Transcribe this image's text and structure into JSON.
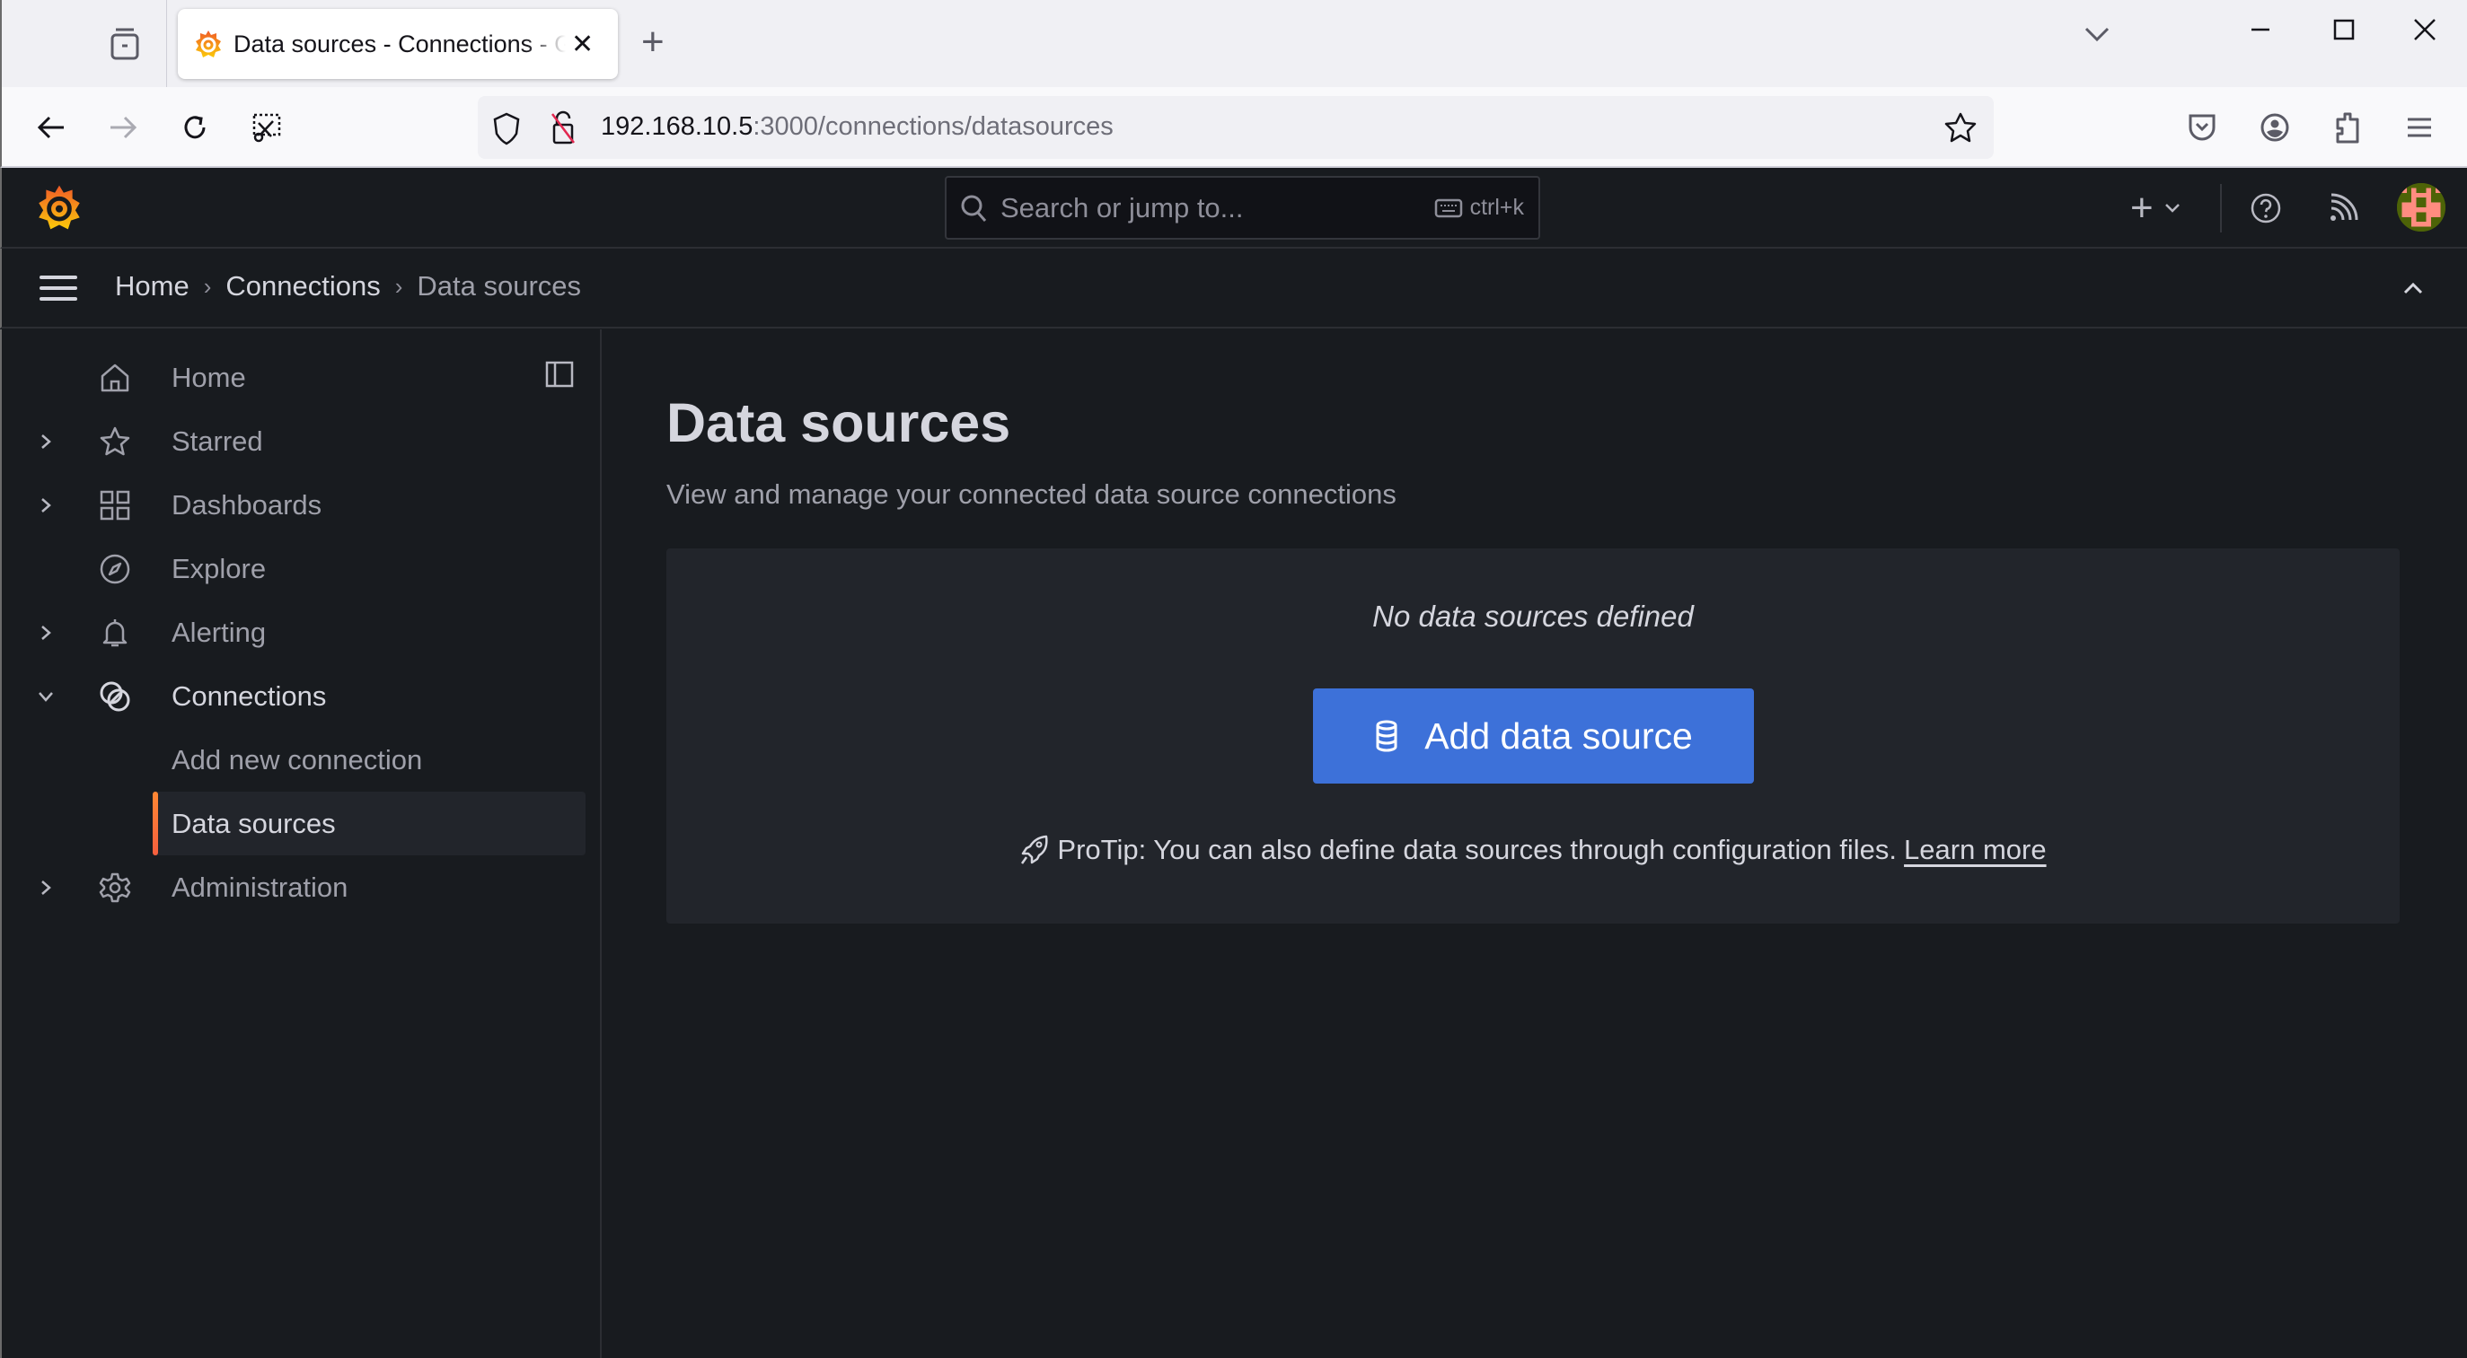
{
  "browser": {
    "tab_title": "Data sources - Connections - Grafana",
    "url_host": "192.168.10.5",
    "url_path": ":3000/connections/datasources",
    "close_tab_glyph": "✕",
    "new_tab_glyph": "+",
    "window_controls": {
      "minimize": "—",
      "maximize": "☐",
      "close": "✕"
    }
  },
  "topbar": {
    "search_placeholder": "Search or jump to...",
    "search_shortcut": "ctrl+k",
    "new_glyph": "+",
    "avatar_colors": {
      "bg": "#4d6307",
      "fg": "#ff8c80"
    }
  },
  "breadcrumb": [
    {
      "label": "Home"
    },
    {
      "label": "Connections"
    },
    {
      "label": "Data sources"
    }
  ],
  "breadcrumb_separator": "›",
  "sidebar": {
    "items": [
      {
        "label": "Home",
        "icon": "home-icon",
        "has_chevron": false
      },
      {
        "label": "Starred",
        "icon": "star-icon",
        "has_chevron": true
      },
      {
        "label": "Dashboards",
        "icon": "apps-icon",
        "has_chevron": true
      },
      {
        "label": "Explore",
        "icon": "compass-icon",
        "has_chevron": false
      },
      {
        "label": "Alerting",
        "icon": "bell-icon",
        "has_chevron": true
      },
      {
        "label": "Connections",
        "icon": "connections-icon",
        "has_chevron": true,
        "expanded": true
      },
      {
        "label": "Add new connection",
        "child": true
      },
      {
        "label": "Data sources",
        "child": true,
        "active": true
      },
      {
        "label": "Administration",
        "icon": "cog-icon",
        "has_chevron": true
      }
    ]
  },
  "main": {
    "title": "Data sources",
    "subtitle": "View and manage your connected data source connections",
    "empty_text": "No data sources defined",
    "add_button_label": "Add data source",
    "protip_text": "ProTip: You can also define data sources through configuration files.",
    "protip_link": "Learn more"
  },
  "colors": {
    "accent_button": "#3d71d9",
    "active_indicator": "#ff8833",
    "background": "#181b1f",
    "panel": "#22252b"
  }
}
